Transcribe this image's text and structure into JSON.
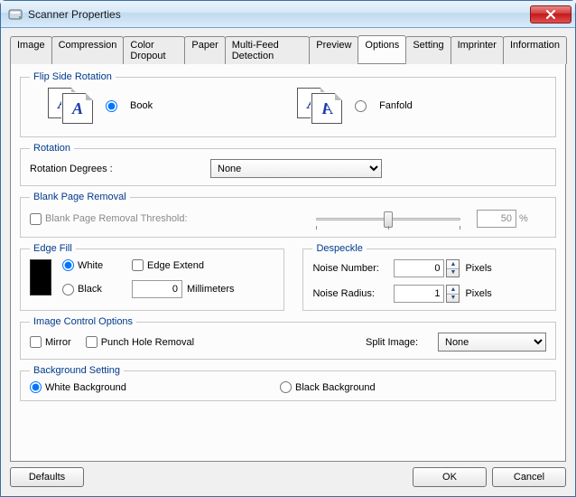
{
  "window": {
    "title": "Scanner Properties"
  },
  "tabs": [
    {
      "label": "Image"
    },
    {
      "label": "Compression"
    },
    {
      "label": "Color Dropout"
    },
    {
      "label": "Paper"
    },
    {
      "label": "Multi-Feed Detection"
    },
    {
      "label": "Preview"
    },
    {
      "label": "Options"
    },
    {
      "label": "Setting"
    },
    {
      "label": "Imprinter"
    },
    {
      "label": "Information"
    }
  ],
  "flip": {
    "legend": "Flip Side Rotation",
    "book": "Book",
    "fanfold": "Fanfold"
  },
  "rotation": {
    "legend": "Rotation",
    "degrees_label": "Rotation Degrees :",
    "value": "None"
  },
  "blank": {
    "legend": "Blank Page Removal",
    "threshold_label": "Blank Page Removal Threshold:",
    "value": "50",
    "unit": "%"
  },
  "edge": {
    "legend": "Edge Fill",
    "white": "White",
    "black": "Black",
    "extend": "Edge Extend",
    "value": "0",
    "unit": "Millimeters"
  },
  "despeckle": {
    "legend": "Despeckle",
    "noise_number_label": "Noise Number:",
    "noise_number_value": "0",
    "noise_radius_label": "Noise Radius:",
    "noise_radius_value": "1",
    "unit": "Pixels"
  },
  "imgctrl": {
    "legend": "Image Control Options",
    "mirror": "Mirror",
    "punch": "Punch Hole Removal",
    "split_label": "Split Image:",
    "split_value": "None"
  },
  "bgset": {
    "legend": "Background Setting",
    "white": "White Background",
    "black": "Black Background"
  },
  "buttons": {
    "defaults": "Defaults",
    "ok": "OK",
    "cancel": "Cancel"
  }
}
